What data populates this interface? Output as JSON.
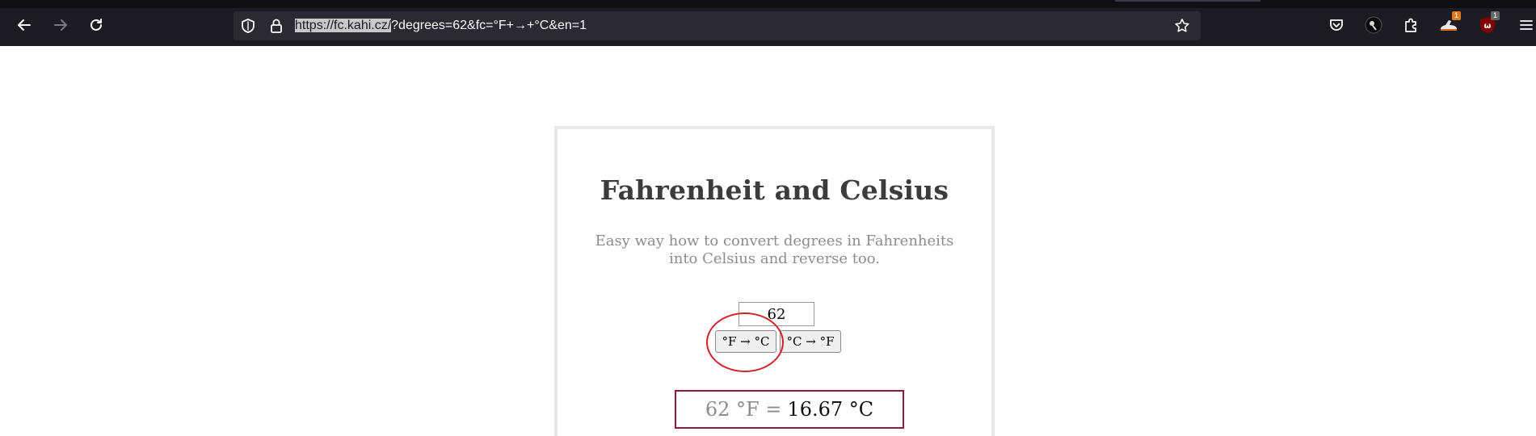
{
  "browser": {
    "url_highlighted": "https://fc.kahi.cz/",
    "url_rest": "?degrees=62&fc=°F+→+°C&en=1",
    "extensions": [
      {
        "name": "pocket-icon",
        "badge": ""
      },
      {
        "name": "extension-avatar-icon",
        "badge": ""
      },
      {
        "name": "extensions-puzzle-icon",
        "badge": ""
      },
      {
        "name": "extension-shoe-icon",
        "badge": "1"
      },
      {
        "name": "ublock-icon",
        "badge": "1"
      }
    ],
    "colors": {
      "chrome_bg": "#1c1b22",
      "urlbar_bg": "#2b2a33",
      "text": "#fbfbfe"
    }
  },
  "page": {
    "title": "Fahrenheit and Celsius",
    "subtitle": "Easy way how to convert degrees in Fahrenheits into Celsius and reverse too.",
    "input_value": "62",
    "btn_f_to_c": "°F → °C",
    "btn_c_to_f": "°C → °F",
    "result_input": "62 °F =",
    "result_output": "16.67 °C",
    "colors": {
      "annotation_circle": "#d22128",
      "result_border": "#8c1a3f",
      "title": "#3c3c3c",
      "muted": "#8c8c8c"
    }
  }
}
